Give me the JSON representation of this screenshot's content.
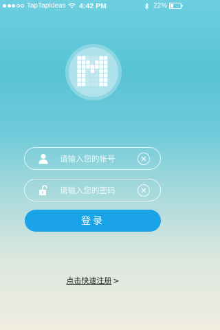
{
  "status_bar": {
    "carrier": "TapTapIdeas",
    "time": "4:42 PM",
    "battery": "22%",
    "signal_icon": "signal-dots-icon",
    "wifi_icon": "wifi-icon",
    "bluetooth_icon": "bluetooth-icon",
    "battery_icon": "battery-icon"
  },
  "logo": {
    "icon": "pixel-m-logo-icon",
    "letter": "M"
  },
  "form": {
    "account_placeholder": "请输入您的帐号",
    "password_placeholder": "请输入您的密码",
    "account_icon": "user-icon",
    "password_icon": "unlock-icon",
    "clear_icon": "close-icon",
    "login_label": "登录"
  },
  "register": {
    "label": "点击快速注册",
    "arrow": ">"
  },
  "colors": {
    "primary": "#1aa3e6",
    "background_top": "#6ccfe0",
    "background_bottom": "#f0ece0"
  }
}
